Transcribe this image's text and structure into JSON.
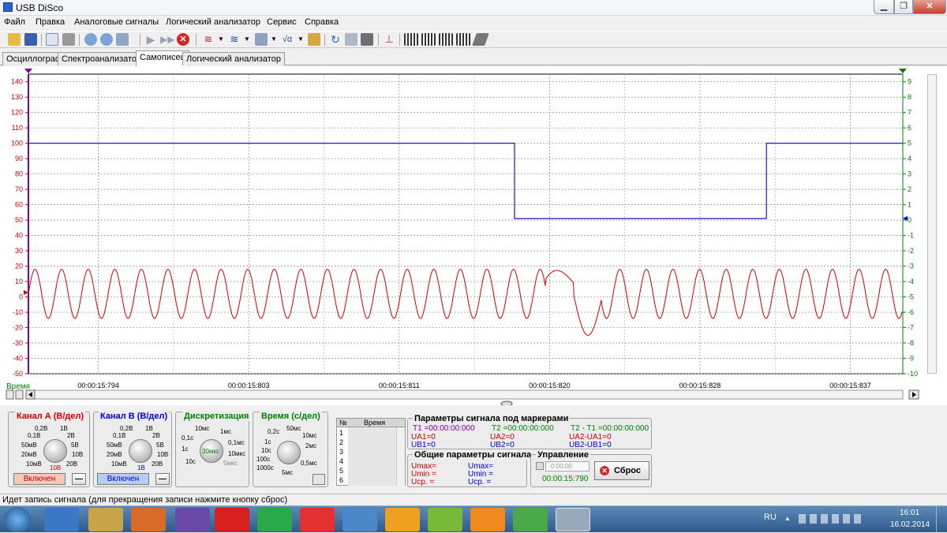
{
  "window": {
    "title": "USB DiSco"
  },
  "menu": [
    "Файл",
    "Правка",
    "Аналоговые сигналы",
    "Логический анализатор",
    "Сервис",
    "Справка"
  ],
  "tabs": [
    {
      "label": "Осциллограф",
      "active": false
    },
    {
      "label": "Спектроанализатор",
      "active": false
    },
    {
      "label": "Самописец",
      "active": true
    },
    {
      "label": "Логический анализатор",
      "active": false
    }
  ],
  "toolbar_icons": [
    "open-icon",
    "save-icon",
    "print-preview-icon",
    "print-icon",
    "zoom-in-icon",
    "zoom-out-icon",
    "export-icon",
    "play-icon",
    "fast-forward-icon",
    "stop-icon",
    "wave-a-icon",
    "wave-b-icon",
    "calculator-icon",
    "formula-icon",
    "sound-icon",
    "refresh-icon",
    "screenshot-icon",
    "calc-icon",
    "trigger-icon",
    "logic-1-icon",
    "logic-2-icon",
    "logic-3-icon",
    "logic-4-icon",
    "probe-icon"
  ],
  "chart_data": {
    "type": "line",
    "title": "",
    "xlabel": "Время",
    "x_ticks": [
      "00:00:15:794",
      "00:00:15:803",
      "00:00:15:811",
      "00:00:15:820",
      "00:00:15:828",
      "00:00:15:837"
    ],
    "y_left": {
      "ticks": [
        140,
        130,
        120,
        110,
        100,
        90,
        80,
        70,
        60,
        50,
        40,
        30,
        20,
        10,
        0,
        -10,
        -20,
        -30,
        -40,
        -50
      ],
      "ylim": [
        -50,
        145
      ],
      "color": "#cc0000"
    },
    "y_right": {
      "ticks": [
        9,
        8,
        7,
        6,
        5,
        4,
        3,
        2,
        1,
        0,
        -1,
        -2,
        -3,
        -4,
        -5,
        -6,
        -7,
        -8,
        -9,
        -10
      ],
      "ylim": [
        -10,
        9.5
      ],
      "color": "#008000"
    },
    "x_range_ms": [
      15790,
      15840
    ],
    "series": [
      {
        "axis": "right",
        "color": "#0000cc",
        "points_ms": [
          [
            15790,
            5
          ],
          [
            15817.8,
            5
          ],
          [
            15817.8,
            0.1
          ],
          [
            15832.2,
            0.1
          ],
          [
            15832.2,
            5
          ],
          [
            15840,
            5
          ]
        ]
      },
      {
        "axis": "left",
        "color": "#cc0000",
        "shape": "sine",
        "amplitude": 16,
        "period_ms": 1.52,
        "offset": 2,
        "disturbance": {
          "start_ms": 15819.6,
          "end_ms": 15822.8,
          "peak": 25,
          "trough": -25
        }
      }
    ],
    "grid": true
  },
  "channel_a": {
    "title": "Канал А (В/дел)",
    "labels": [
      "0,2В",
      "1В",
      "0,1В",
      "2В",
      "50мВ",
      "5В",
      "20мВ",
      "10В",
      "10мВ",
      "20В"
    ],
    "value": "10В",
    "button": "Включен",
    "minus": "—"
  },
  "channel_b": {
    "title": "Канал B (В/дел)",
    "labels": [
      "0,2В",
      "1В",
      "0,1В",
      "2В",
      "50мВ",
      "5В",
      "20мВ",
      "10В",
      "10мВ",
      "20В"
    ],
    "value": "1В",
    "button": "Включен",
    "minus": "—"
  },
  "sampling": {
    "title": "Дискретизация",
    "labels": [
      "10мс",
      "1мс",
      "0,1с",
      "0,1мс",
      "1с",
      "10мкс",
      "10с",
      "5мкс"
    ],
    "value": "30мкс"
  },
  "timebase": {
    "title": "Время (с/дел)",
    "labels": [
      "0,2с",
      "50мс",
      "1с",
      "10мс",
      "10с",
      "2мс",
      "100с",
      "0,5мс",
      "1000с",
      "5мс"
    ]
  },
  "marker_table": {
    "col_n": "№",
    "col_time": "Время",
    "rows": [
      "1",
      "2",
      "3",
      "4",
      "5",
      "6"
    ]
  },
  "marker_params": {
    "title": "Параметры сигнала под маркерами",
    "t1": "T1 =00:00:00:000",
    "ua1": "UA1=0",
    "ub1": "UB1=0",
    "t2": "T2 =00:00:00:000",
    "ua2": "UA2=0",
    "ub2": "UB2=0",
    "dt": "T2 - T1 =00:00:00:000",
    "dua": "UA2-UA1=0",
    "dub": "UB2-UB1=0"
  },
  "general_params": {
    "title": "Общие параметры сигнала",
    "a": [
      "Umax=",
      "Umin =",
      "Ucp. ="
    ],
    "b": [
      "Umax=",
      "Umin =",
      "Ucp. ="
    ]
  },
  "control": {
    "title": "Управление",
    "spin_value": "0:00:00",
    "time": "00:00:15:790",
    "reset": "Сброс"
  },
  "status_text": "Идет запись сигнала (для прекращения записи нажмите кнопку сброс)",
  "taskbar": {
    "lang": "RU",
    "time": "16:01",
    "date": "16.02.2014",
    "apps": [
      "windows-start-icon",
      "ie-icon",
      "explorer-icon",
      "media-icon",
      "vs-icon",
      "yandex-browser-icon",
      "mail-agent-icon",
      "yandex-icon",
      "volume-app-icon",
      "mail-icon",
      "aimp-icon",
      "odnoklassniki-icon",
      "utorrent-icon",
      "disco-icon"
    ]
  }
}
